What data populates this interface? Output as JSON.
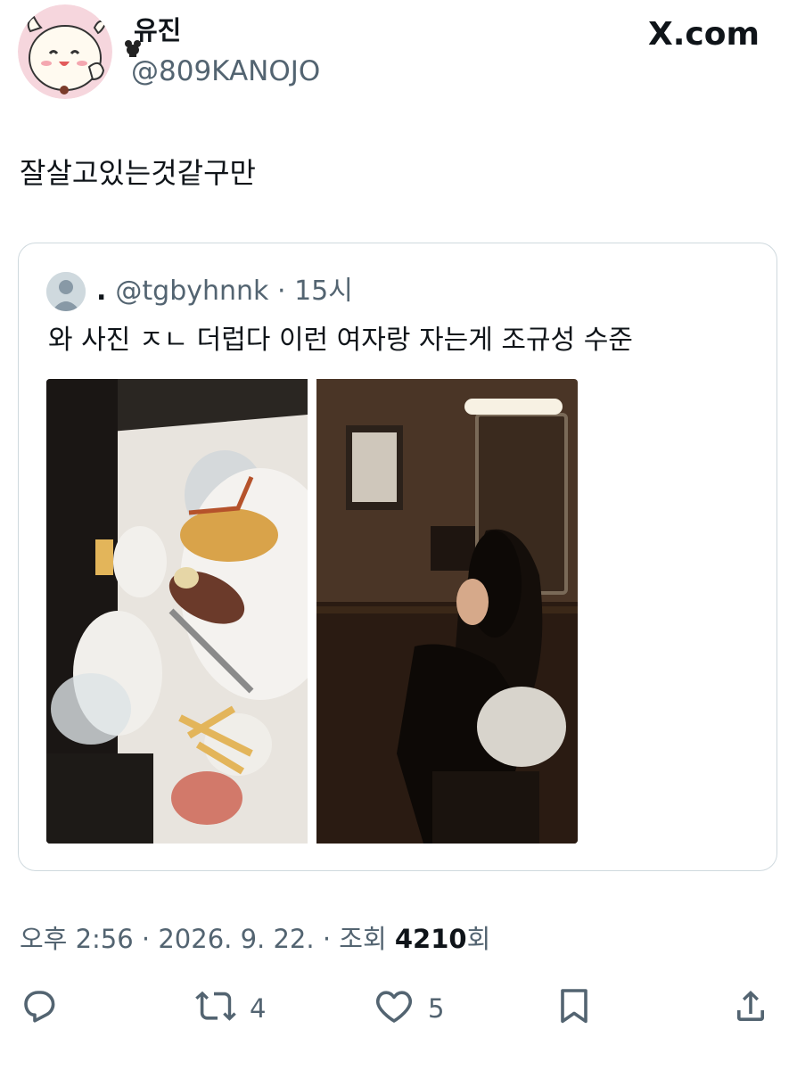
{
  "header": {
    "display_name": "유진",
    "handle": "@809KANOJO",
    "site_logo": "X.com"
  },
  "tweet": {
    "text": "잘살고있는것같구만"
  },
  "quote": {
    "author_name": ".",
    "handle": "@tgbyhnnk",
    "time": "15시",
    "separator": "·",
    "text": "와 사진 ㅈㄴ 더럽다 이런 여자랑 자는게 조규성 수준",
    "photos": [
      "photo-restaurant-table-food",
      "photo-woman-sitting-dark-room"
    ]
  },
  "meta": {
    "time": "오후 2:56",
    "date": "2026. 9. 22.",
    "views_label": "조회",
    "views_count": "4210",
    "views_suffix": "회",
    "separator": "·"
  },
  "actions": {
    "reply_icon": "reply-icon",
    "retweet_icon": "retweet-icon",
    "retweet_count": "4",
    "like_icon": "heart-icon",
    "like_count": "5",
    "bookmark_icon": "bookmark-icon",
    "share_icon": "share-icon"
  },
  "colors": {
    "text": "#0f1419",
    "secondary": "#536471",
    "border": "#cfd9de"
  }
}
